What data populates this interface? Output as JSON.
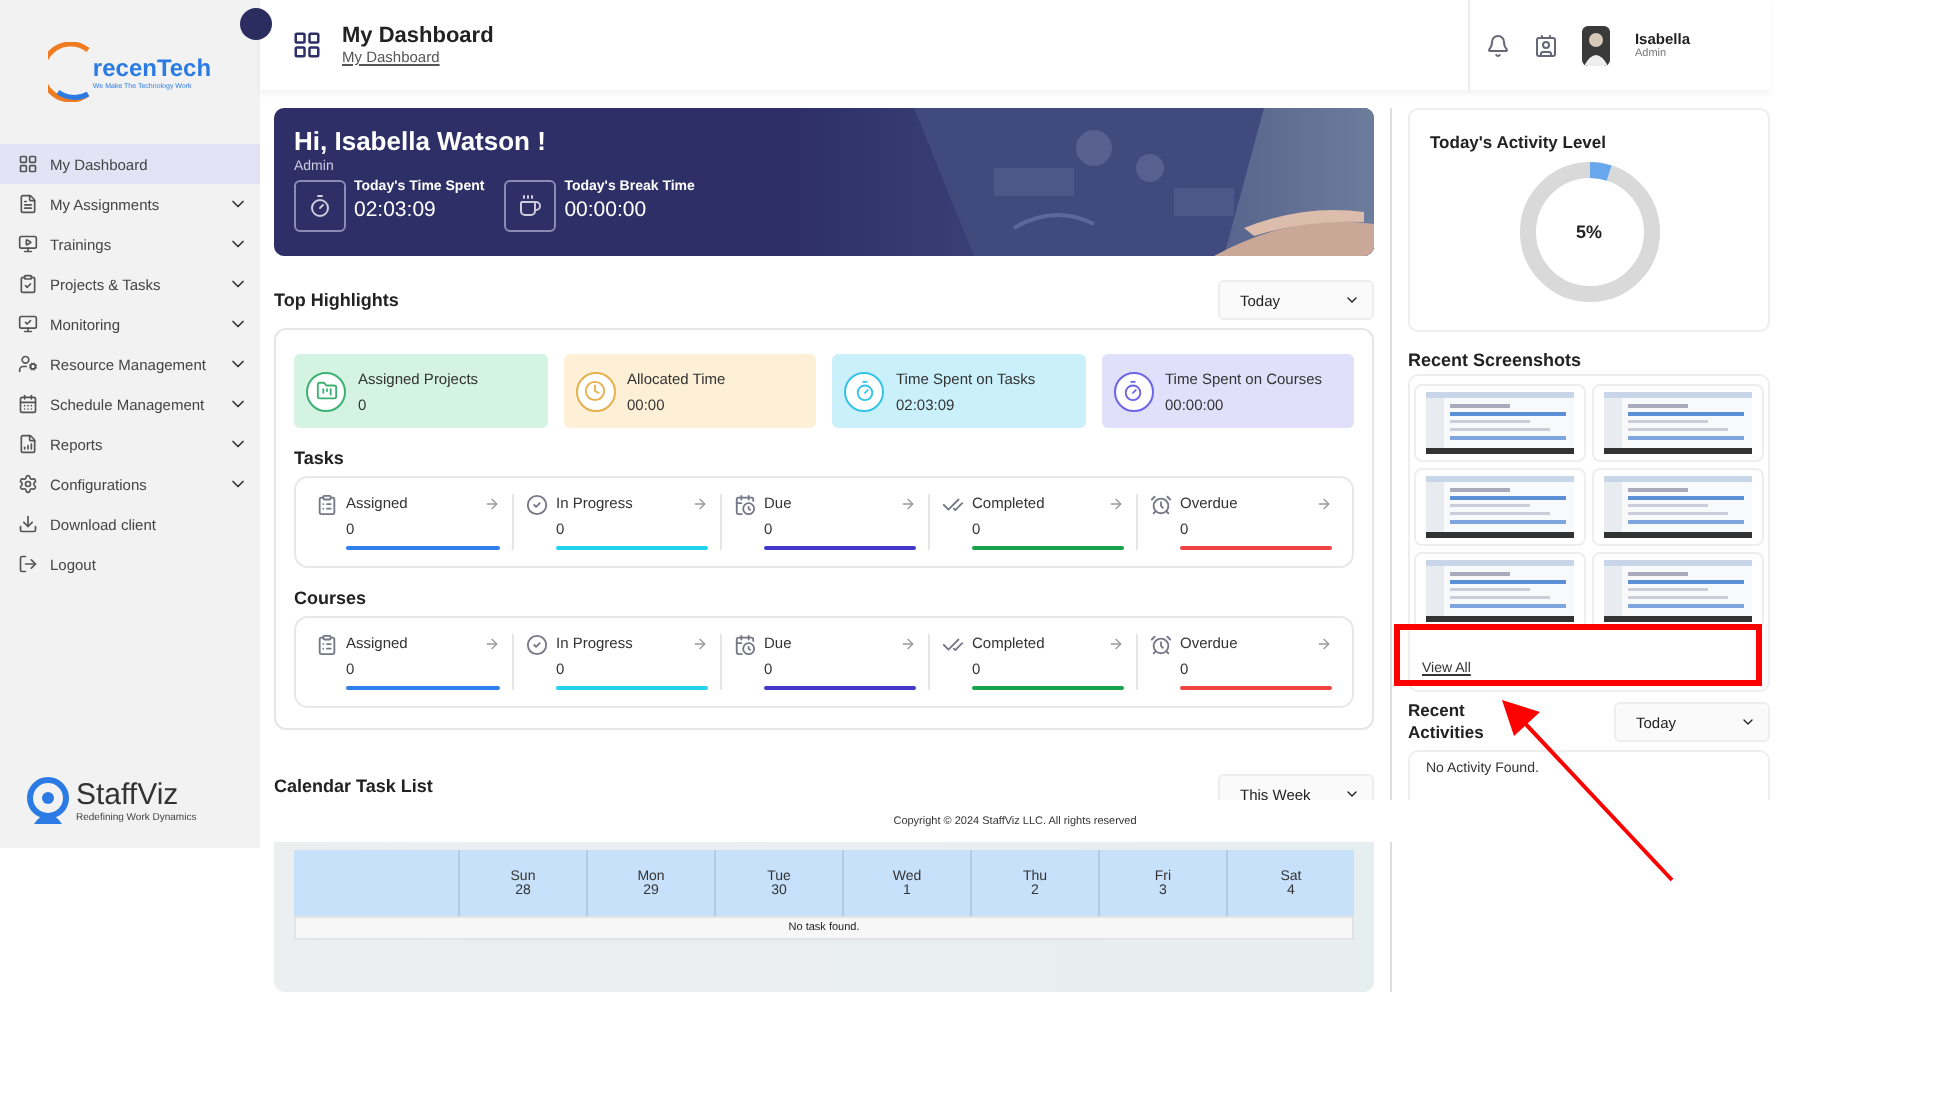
{
  "sidebar": {
    "logo": {
      "name": "recenTech",
      "tagline": "We Make The Technology Work"
    },
    "items": [
      {
        "label": "My Dashboard",
        "selected": true,
        "expandable": false
      },
      {
        "label": "My Assignments",
        "selected": false,
        "expandable": true
      },
      {
        "label": "Trainings",
        "selected": false,
        "expandable": true
      },
      {
        "label": "Projects & Tasks",
        "selected": false,
        "expandable": true
      },
      {
        "label": "Monitoring",
        "selected": false,
        "expandable": true
      },
      {
        "label": "Resource Management",
        "selected": false,
        "expandable": true
      },
      {
        "label": "Schedule Management",
        "selected": false,
        "expandable": true
      },
      {
        "label": "Reports",
        "selected": false,
        "expandable": true
      },
      {
        "label": "Configurations",
        "selected": false,
        "expandable": true
      },
      {
        "label": "Download client",
        "selected": false,
        "expandable": false
      },
      {
        "label": "Logout",
        "selected": false,
        "expandable": false
      }
    ],
    "footer_logo": {
      "name": "StaffViz",
      "tagline": "Redefining Work Dynamics"
    }
  },
  "header": {
    "title": "My Dashboard",
    "breadcrumb": "My Dashboard",
    "user": {
      "name": "Isabella",
      "role": "Admin"
    }
  },
  "banner": {
    "greeting": "Hi, Isabella Watson !",
    "role": "Admin",
    "stats": [
      {
        "label": "Today's Time Spent",
        "value": "02:03:09"
      },
      {
        "label": "Today's Break Time",
        "value": "00:00:00"
      }
    ]
  },
  "highlights": {
    "title": "Top Highlights",
    "period": "Today",
    "cards": [
      {
        "label": "Assigned Projects",
        "value": "0",
        "color": "#d4f3e2"
      },
      {
        "label": "Allocated Time",
        "value": "00:00",
        "color": "#fdf0d6"
      },
      {
        "label": "Time Spent on Tasks",
        "value": "02:03:09",
        "color": "#c9f0fb"
      },
      {
        "label": "Time Spent on Courses",
        "value": "00:00:00",
        "color": "#e1e0fb"
      }
    ],
    "groups": [
      {
        "title": "Tasks",
        "items": [
          {
            "label": "Assigned",
            "value": "0",
            "color": "#2f80ed"
          },
          {
            "label": "In Progress",
            "value": "0",
            "color": "#22d3ee"
          },
          {
            "label": "Due",
            "value": "0",
            "color": "#4338ca"
          },
          {
            "label": "Completed",
            "value": "0",
            "color": "#16a34a"
          },
          {
            "label": "Overdue",
            "value": "0",
            "color": "#ef4444"
          }
        ]
      },
      {
        "title": "Courses",
        "items": [
          {
            "label": "Assigned",
            "value": "0",
            "color": "#2f80ed"
          },
          {
            "label": "In Progress",
            "value": "0",
            "color": "#22d3ee"
          },
          {
            "label": "Due",
            "value": "0",
            "color": "#4338ca"
          },
          {
            "label": "Completed",
            "value": "0",
            "color": "#16a34a"
          },
          {
            "label": "Overdue",
            "value": "0",
            "color": "#ef4444"
          }
        ]
      }
    ]
  },
  "calendar": {
    "title": "Calendar Task List",
    "period": "This Week",
    "days": [
      {
        "day": "Sun",
        "date": "28"
      },
      {
        "day": "Mon",
        "date": "29"
      },
      {
        "day": "Tue",
        "date": "30"
      },
      {
        "day": "Wed",
        "date": "1"
      },
      {
        "day": "Thu",
        "date": "2"
      },
      {
        "day": "Fri",
        "date": "3"
      },
      {
        "day": "Sat",
        "date": "4"
      }
    ],
    "empty": "No task found."
  },
  "footer": "Copyright © 2024 StaffViz LLC. All rights reserved",
  "activity": {
    "title": "Today's Activity Level",
    "level": 0.05,
    "reading": "5%"
  },
  "screenshots": {
    "title": "Recent Screenshots",
    "link": "View All"
  },
  "recent_activities": {
    "title": "Recent Activities",
    "period": "Today",
    "empty": "No Activity Found."
  },
  "annotations": [
    {
      "kind": "box"
    },
    {
      "kind": "arrow"
    }
  ]
}
